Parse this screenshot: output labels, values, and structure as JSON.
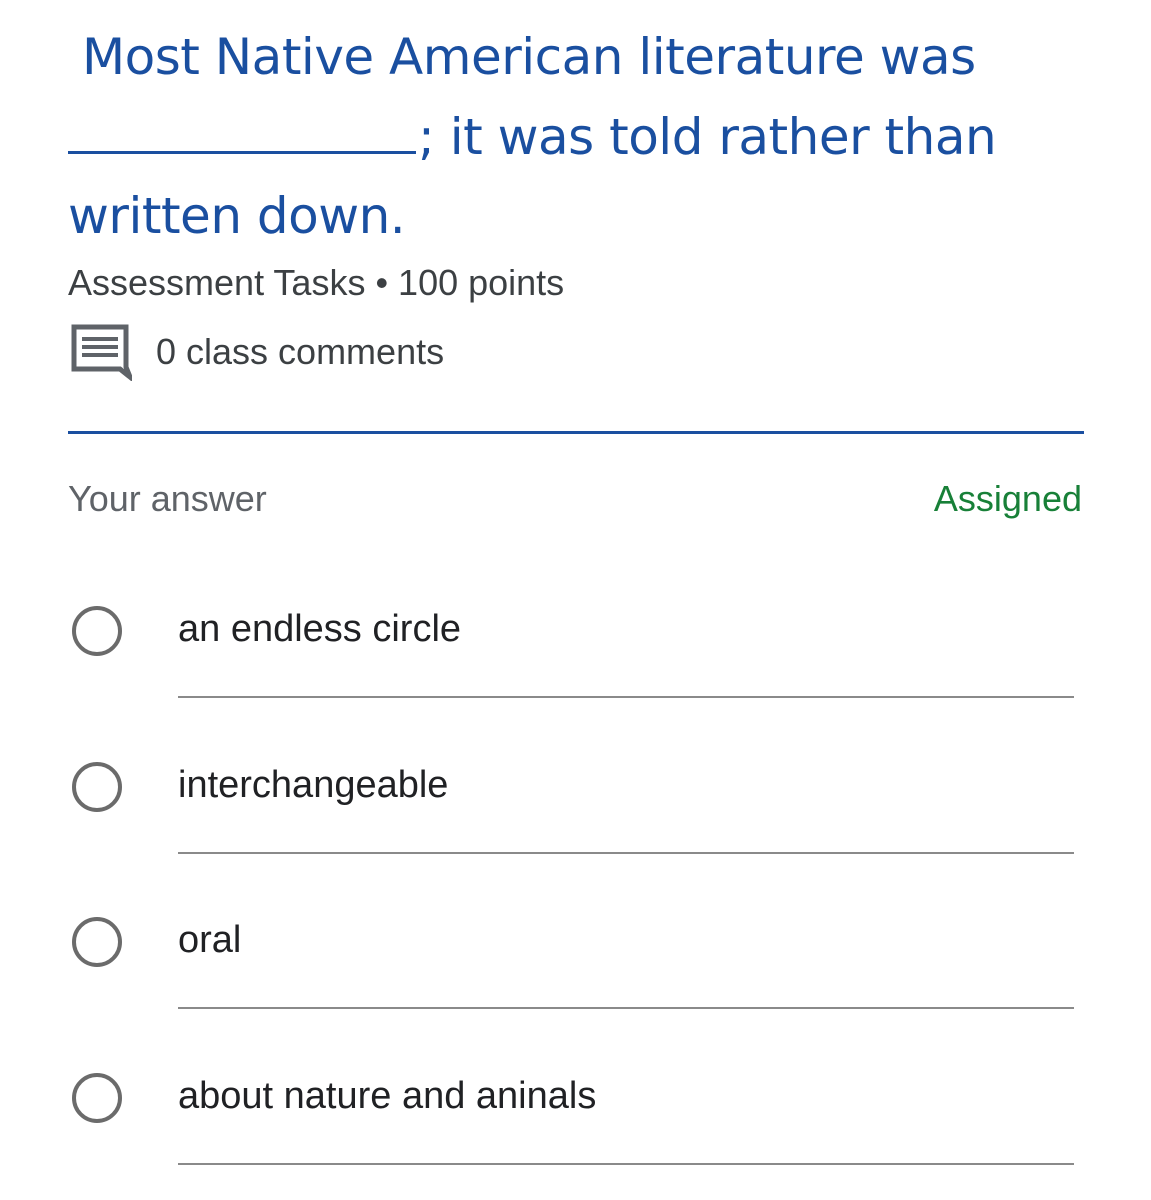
{
  "question": {
    "line1": "Most Native American literature was",
    "line2_after_blank": "; it was told rather than",
    "line3": "written down."
  },
  "meta": "Assessment Tasks • 100 points",
  "comments": {
    "icon": "comment-icon",
    "label": "0 class comments"
  },
  "answer_section": {
    "label": "Your answer",
    "status": "Assigned"
  },
  "options": [
    {
      "label": "an endless circle",
      "selected": false
    },
    {
      "label": "interchangeable",
      "selected": false
    },
    {
      "label": "oral",
      "selected": false
    },
    {
      "label": "about nature and aninals",
      "selected": false
    }
  ],
  "colors": {
    "question": "#1a4fa0",
    "status": "#188038",
    "divider": "#1a4fa0"
  }
}
